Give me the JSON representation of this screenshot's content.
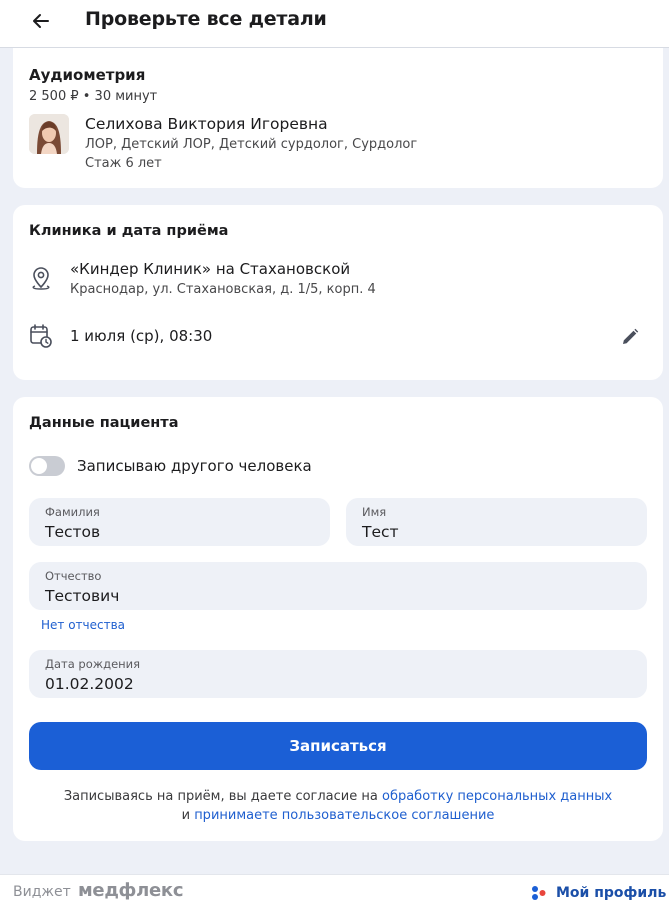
{
  "header": {
    "title": "Проверьте все детали"
  },
  "service": {
    "name": "Аудиометрия",
    "meta": "2 500 ₽ • 30 минут",
    "doctor": {
      "name": "Селихова Виктория Игоревна",
      "specialties": "ЛОР, Детский ЛОР, Детский сурдолог, Сурдолог",
      "experience": "Стаж 6 лет"
    }
  },
  "clinic": {
    "section_title": "Клиника и дата приёма",
    "name": "«Киндер Клиник» на Стахановской",
    "address": "Краснодар, ул. Стахановская, д. 1/5, корп. 4",
    "datetime": "1 июля (ср), 08:30"
  },
  "patient": {
    "section_title": "Данные пациента",
    "toggle_label": "Записываю другого человека",
    "toggle_on": false,
    "fields": {
      "last_name": {
        "label": "Фамилия",
        "value": "Тестов"
      },
      "first_name": {
        "label": "Имя",
        "value": "Тест"
      },
      "middle_name": {
        "label": "Отчество",
        "value": "Тестович"
      },
      "birth_date": {
        "label": "Дата рождения",
        "value": "01.02.2002"
      }
    },
    "no_middle_name_link": "Нет отчества",
    "submit_label": "Записаться",
    "consent": {
      "prefix": "Записываясь на приём, вы даете согласие на",
      "link1": "обработку персональных данных",
      "conj": "и",
      "link2": "принимаете пользовательское соглашение"
    }
  },
  "footer": {
    "widget_label": "Виджет",
    "brand": "медфлекс",
    "profile_label": "Мой профиль"
  },
  "colors": {
    "accent": "#1b5fd6",
    "link": "#1f5fcf",
    "background": "#edf0f7",
    "field_bg": "#eef1f7"
  },
  "icons": [
    "arrow-left-icon",
    "map-pin-icon",
    "calendar-clock-icon",
    "pencil-icon",
    "dots-logo-icon"
  ]
}
